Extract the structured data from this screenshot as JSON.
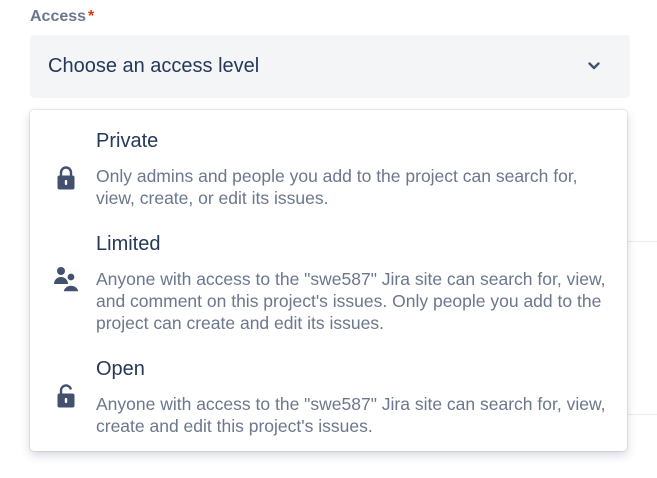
{
  "field": {
    "label": "Access",
    "required_marker": "*"
  },
  "select": {
    "placeholder": "Choose an access level",
    "icon": "chevron-down-icon"
  },
  "options": [
    {
      "title": "Private",
      "description": "Only admins and people you add to the project can search for, view, create, or edit its issues.",
      "icon": "lock-icon"
    },
    {
      "title": "Limited",
      "description": "Anyone with access to the \"swe587\" Jira site can search for, view, and comment on this project's issues. Only people you add to the project can create and edit its issues.",
      "icon": "people-icon"
    },
    {
      "title": "Open",
      "description": "Anyone with access to the \"swe587\" Jira site can search for, view, create and edit this project's issues.",
      "icon": "unlock-icon"
    }
  ],
  "colors": {
    "label": "#6b778c",
    "required": "#de350b",
    "text_primary": "#253858",
    "text_secondary": "#6b778c",
    "icon": "#42526e",
    "select_bg": "#f4f5f7"
  }
}
